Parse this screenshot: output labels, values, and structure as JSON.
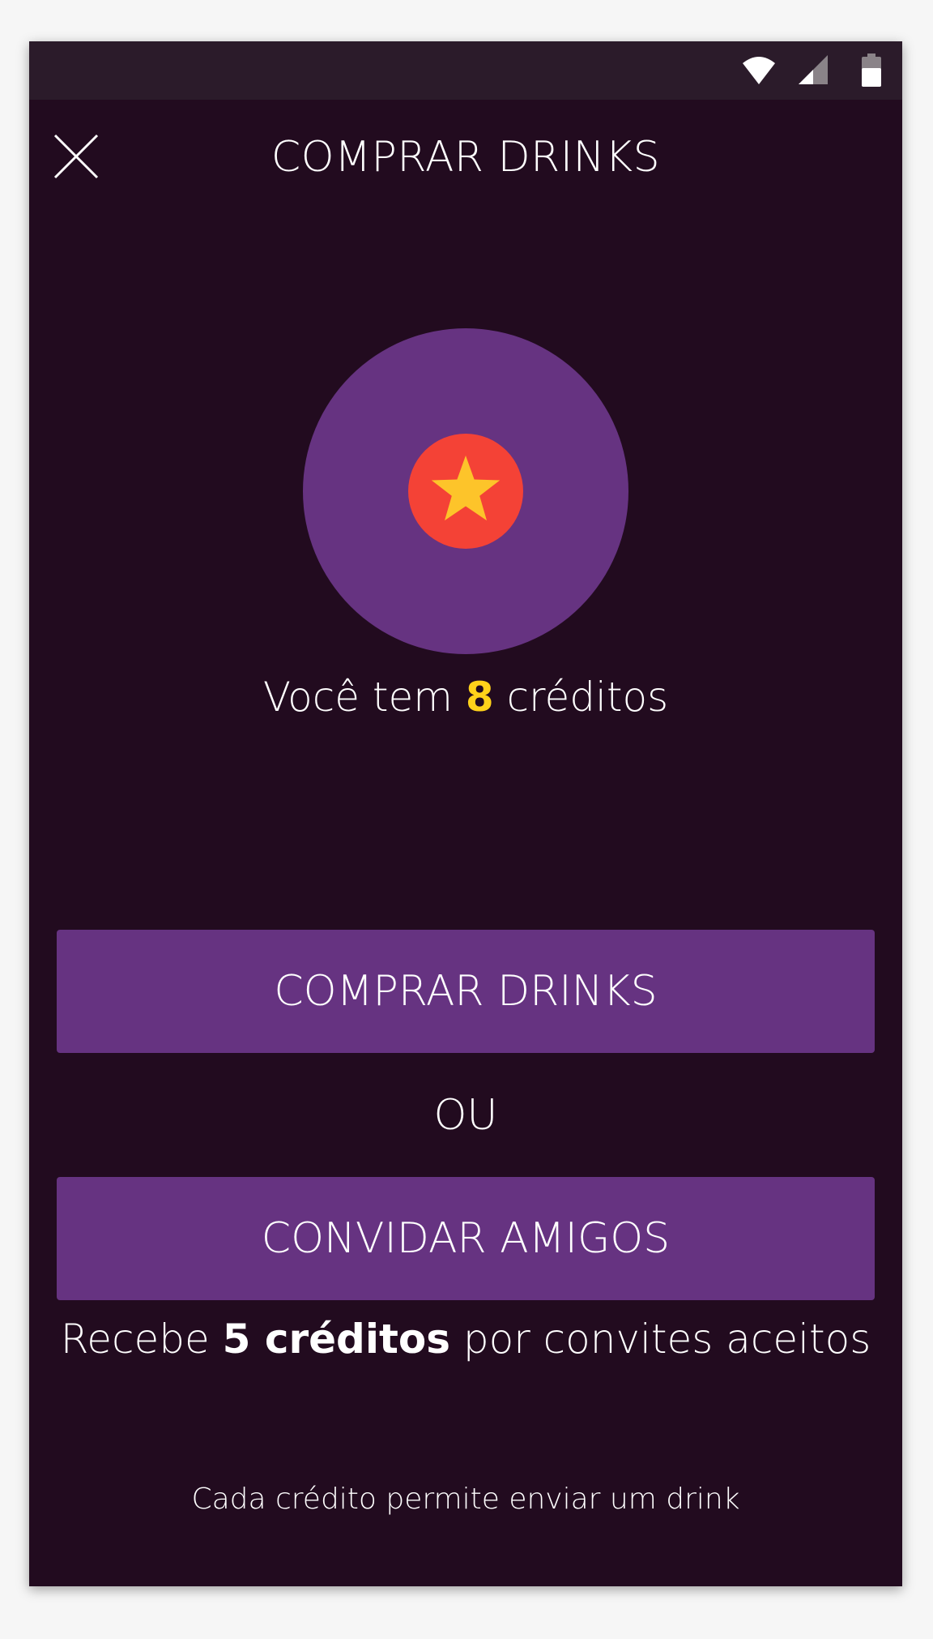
{
  "colors": {
    "background": "#220b1f",
    "status_bar": "#2b1b2a",
    "accent_purple": "#663381",
    "highlight_yellow": "#ffd21a",
    "badge_red": "#f44236",
    "star_yellow": "#fdc42a"
  },
  "status_bar": {
    "icons": [
      "wifi-icon",
      "signal-icon",
      "battery-icon"
    ]
  },
  "header": {
    "title": "COMPRAR DRINKS",
    "close_icon": "close-icon"
  },
  "hero": {
    "badge_icon": "star-icon"
  },
  "credits": {
    "prefix": "Você tem ",
    "count": "8",
    "suffix": " créditos"
  },
  "actions": {
    "buy_label": "COMPRAR DRINKS",
    "or_label": "OU",
    "invite_label": "CONVIDAR AMIGOS"
  },
  "invite_note": {
    "prefix": "Recebe ",
    "bold": "5 créditos",
    "suffix": " por convites aceitos"
  },
  "footnote": "Cada crédito permite enviar um drink"
}
